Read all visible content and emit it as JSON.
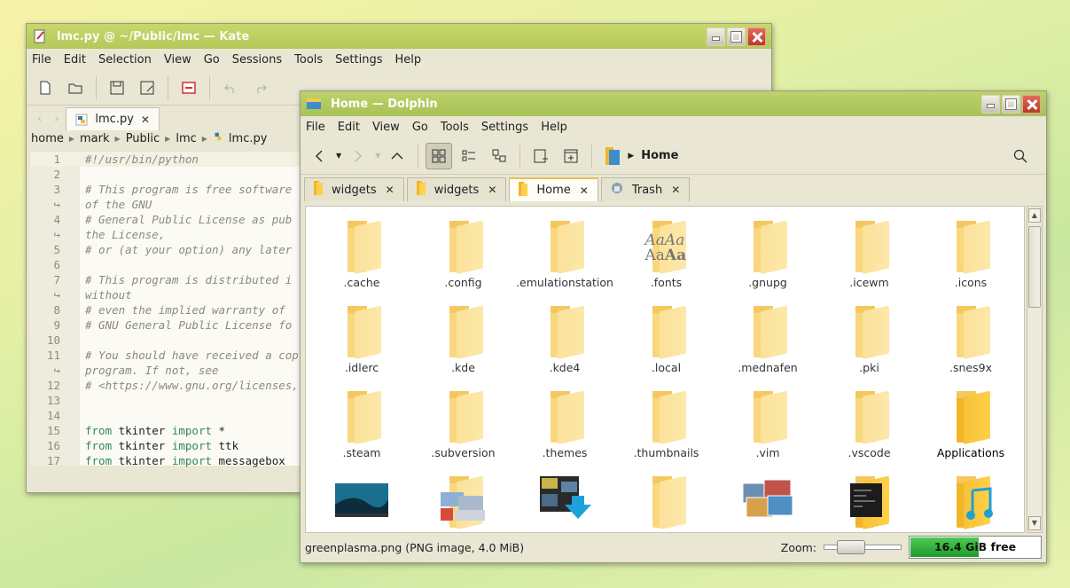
{
  "kate": {
    "title": "lmc.py @ ~/Public/lmc — Kate",
    "menu": [
      "File",
      "Edit",
      "Selection",
      "View",
      "Go",
      "Sessions",
      "Tools",
      "Settings",
      "Help"
    ],
    "tab": "lmc.py",
    "breadcrumb": [
      "home",
      "mark",
      "Public",
      "lmc",
      "lmc.py"
    ],
    "lines": [
      {
        "n": "1",
        "t": "#!/usr/bin/python",
        "k": "cmt"
      },
      {
        "n": "2",
        "t": "",
        "k": ""
      },
      {
        "n": "3",
        "t": "# This program is free software",
        "k": "cmt"
      },
      {
        "n": "↪",
        "t": "of the GNU",
        "k": "cmt"
      },
      {
        "n": "4",
        "t": "# General Public License as pub",
        "k": "cmt"
      },
      {
        "n": "↪",
        "t": "the License,",
        "k": "cmt"
      },
      {
        "n": "5",
        "t": "# or (at your option) any later",
        "k": "cmt"
      },
      {
        "n": "6",
        "t": "",
        "k": ""
      },
      {
        "n": "7",
        "t": "# This program is distributed i",
        "k": "cmt"
      },
      {
        "n": "↪",
        "t": "without",
        "k": "cmt"
      },
      {
        "n": "8",
        "t": "# even the implied warranty of",
        "k": "cmt"
      },
      {
        "n": "9",
        "t": "# GNU General Public License fo",
        "k": "cmt"
      },
      {
        "n": "10",
        "t": "",
        "k": ""
      },
      {
        "n": "11",
        "t": "# You should have received a cop",
        "k": "cmt"
      },
      {
        "n": "↪",
        "t": "program. If not, see",
        "k": "cmt"
      },
      {
        "n": "12",
        "t": "# <https://www.gnu.org/licenses,",
        "k": "cmt"
      },
      {
        "n": "13",
        "t": "",
        "k": ""
      },
      {
        "n": "14",
        "t": "",
        "k": ""
      },
      {
        "n": "15",
        "t": "from tkinter import *",
        "k": "code"
      },
      {
        "n": "16",
        "t": "from tkinter import ttk",
        "k": "code"
      },
      {
        "n": "17",
        "t": "from tkinter import messagebox",
        "k": "code"
      }
    ]
  },
  "dolphin": {
    "title": "Home — Dolphin",
    "menu": [
      "File",
      "Edit",
      "View",
      "Go",
      "Tools",
      "Settings",
      "Help"
    ],
    "location": "Home",
    "tabs": [
      "widgets",
      "widgets",
      "Home",
      "Trash"
    ],
    "items": [
      {
        "label": ".cache",
        "icon": "folder-icon"
      },
      {
        "label": ".config",
        "icon": "folder-icon"
      },
      {
        "label": ".emulationstation",
        "icon": "folder-icon"
      },
      {
        "label": ".fonts",
        "icon": "fonts-icon"
      },
      {
        "label": ".gnupg",
        "icon": "folder-icon"
      },
      {
        "label": ".icewm",
        "icon": "folder-icon"
      },
      {
        "label": ".icons",
        "icon": "folder-icon"
      },
      {
        "label": ".idlerc",
        "icon": "folder-icon"
      },
      {
        "label": ".kde",
        "icon": "folder-icon"
      },
      {
        "label": ".kde4",
        "icon": "folder-icon"
      },
      {
        "label": ".local",
        "icon": "folder-icon"
      },
      {
        "label": ".mednafen",
        "icon": "folder-icon"
      },
      {
        "label": ".pki",
        "icon": "folder-icon"
      },
      {
        "label": ".snes9x",
        "icon": "folder-icon"
      },
      {
        "label": ".steam",
        "icon": "folder-icon"
      },
      {
        "label": ".subversion",
        "icon": "folder-icon"
      },
      {
        "label": ".themes",
        "icon": "folder-icon"
      },
      {
        "label": ".thumbnails",
        "icon": "folder-icon"
      },
      {
        "label": ".vim",
        "icon": "folder-icon"
      },
      {
        "label": ".vscode",
        "icon": "folder-icon"
      },
      {
        "label": "Applications",
        "icon": "applications-folder-icon"
      },
      {
        "label": "",
        "icon": "desktop-image-icon"
      },
      {
        "label": "",
        "icon": "documents-folder-icon"
      },
      {
        "label": "",
        "icon": "downloads-folder-icon"
      },
      {
        "label": "",
        "icon": "folder-icon"
      },
      {
        "label": "",
        "icon": "pictures-folder-icon"
      },
      {
        "label": "",
        "icon": "terminal-folder-icon"
      },
      {
        "label": "",
        "icon": "music-folder-icon"
      }
    ],
    "status": "greenplasma.png (PNG image, 4.0 MiB)",
    "zoom_label": "Zoom:",
    "free_space": "16.4 GiB free",
    "free_fraction": 0.52
  },
  "colors": {
    "accent": "#b4c95a",
    "folder": "#fbe29b",
    "space_bar": "#2ea83a"
  }
}
